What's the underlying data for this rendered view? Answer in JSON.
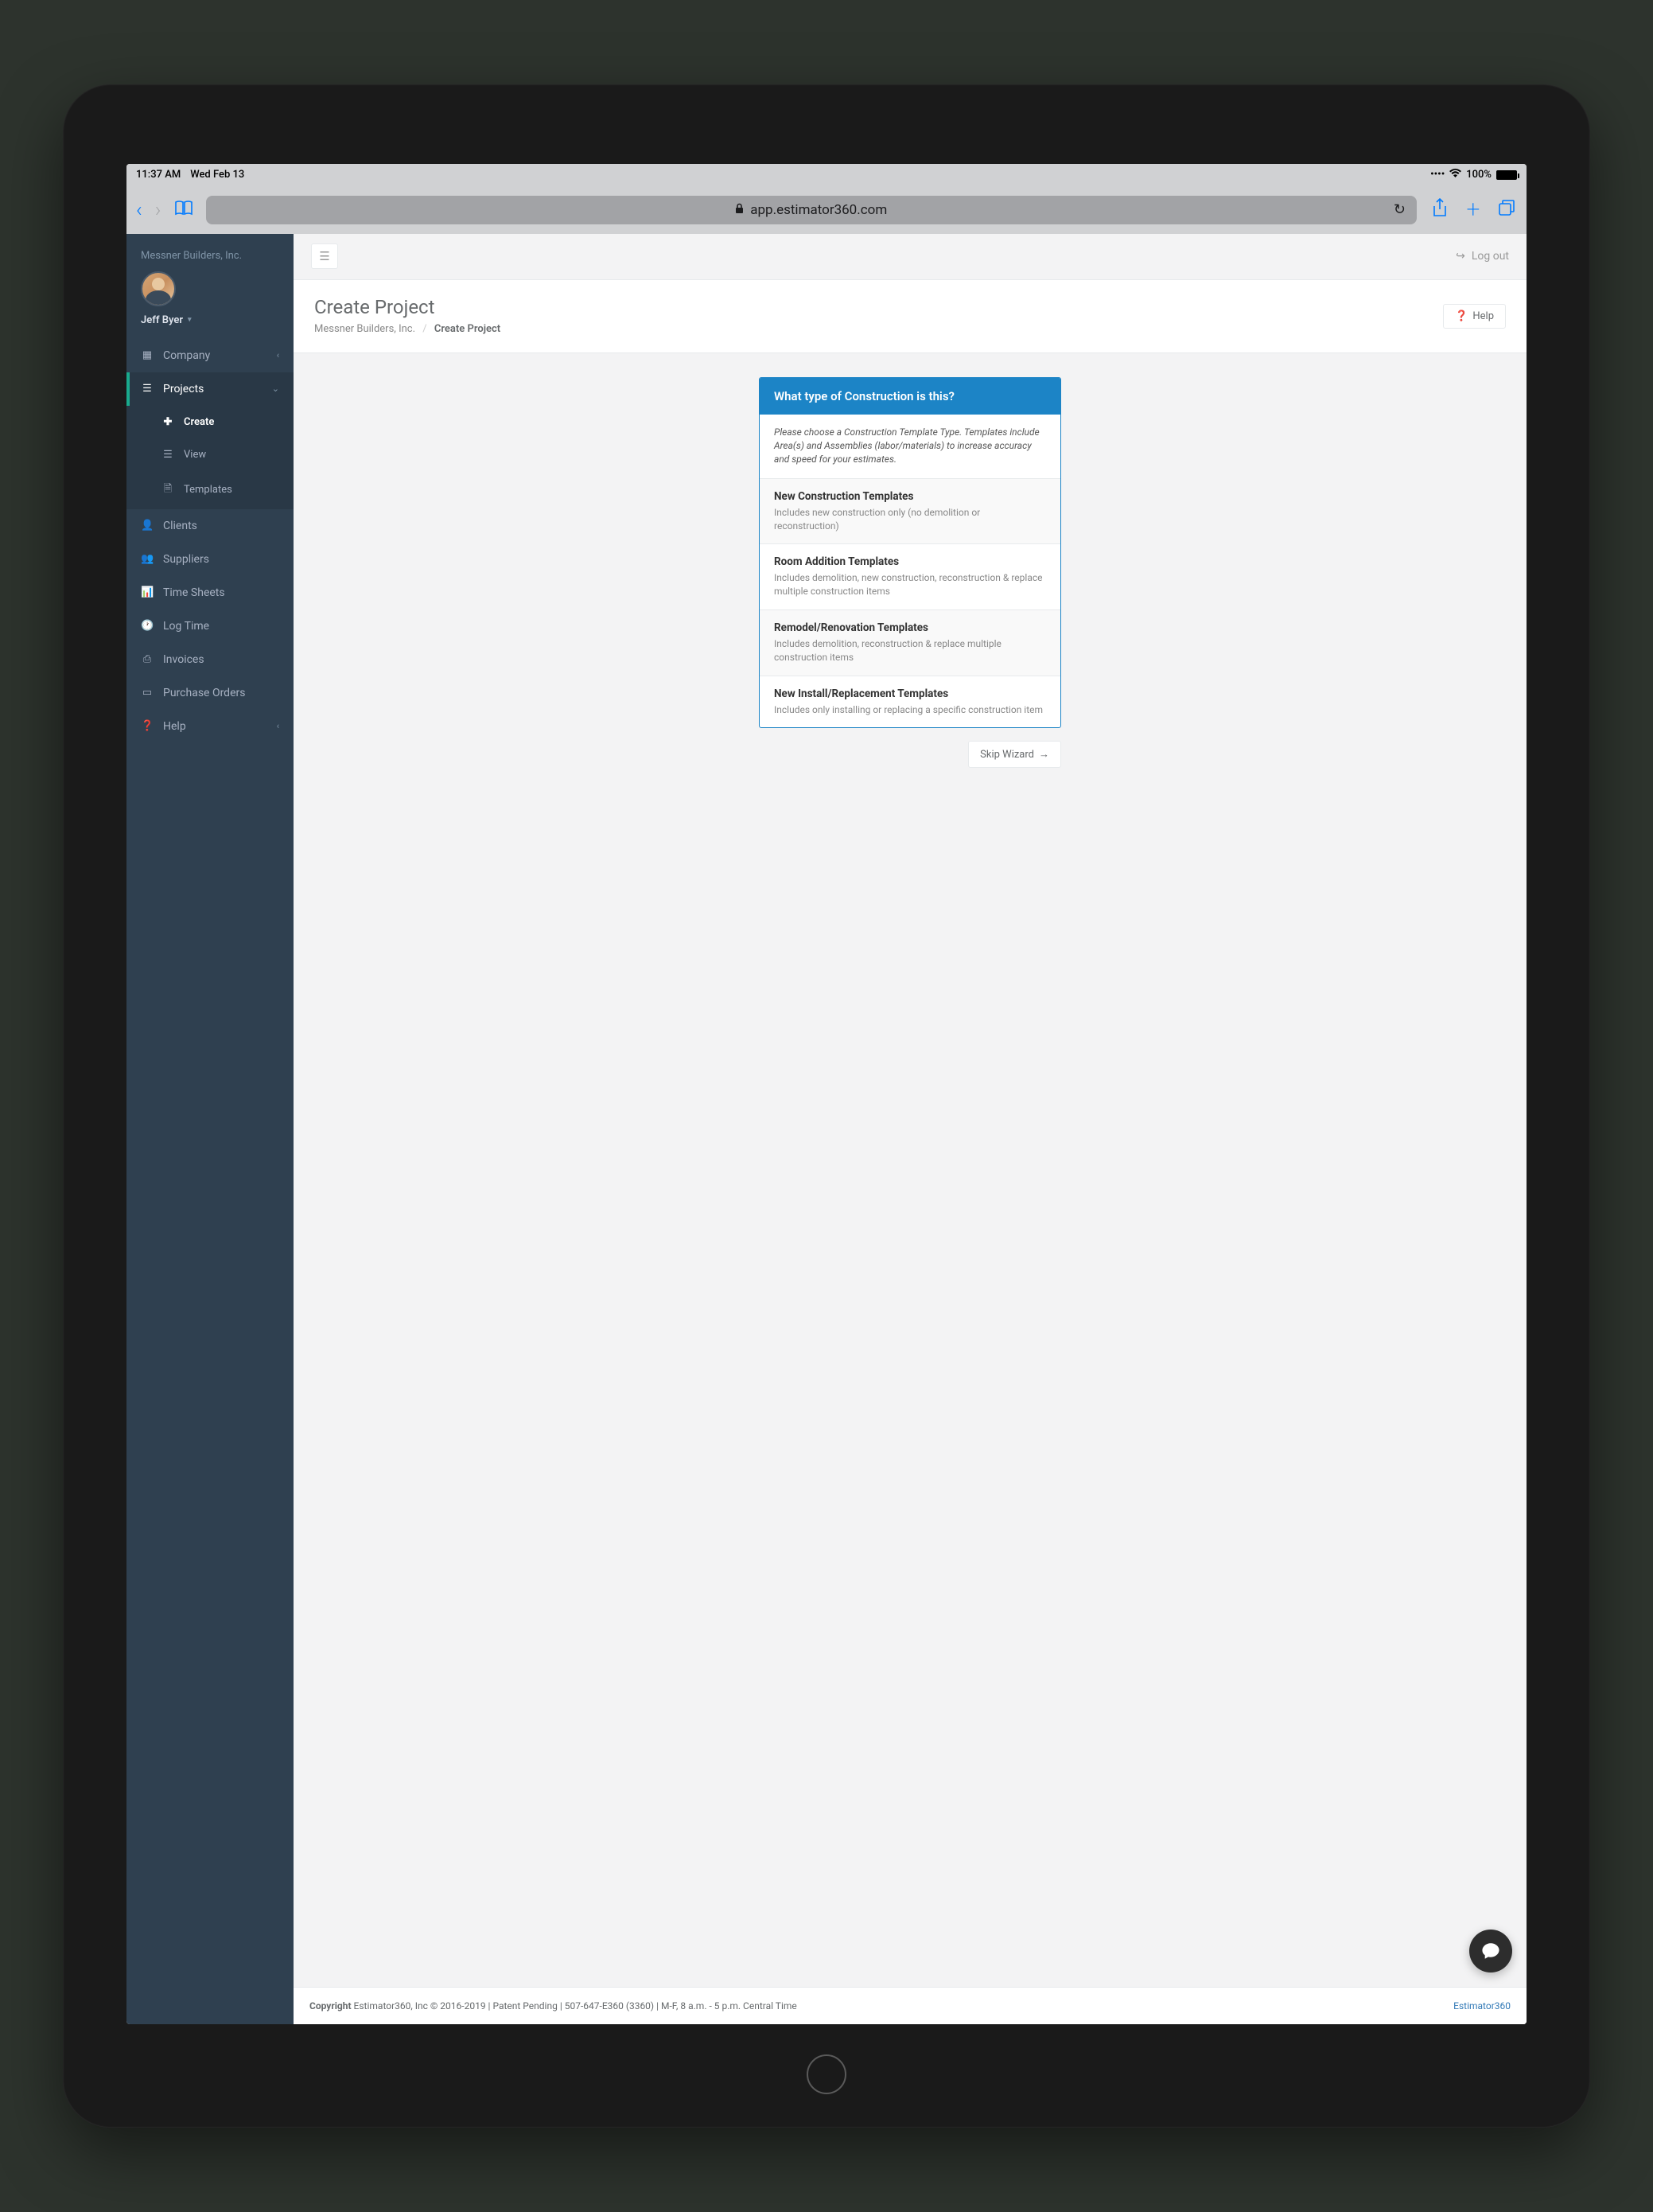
{
  "status_bar": {
    "time": "11:37 AM",
    "date": "Wed Feb 13",
    "battery": "100%"
  },
  "browser": {
    "url": "app.estimator360.com"
  },
  "sidebar": {
    "company": "Messner Builders, Inc.",
    "user": "Jeff Byer",
    "nav": {
      "company": "Company",
      "projects": "Projects",
      "create": "Create",
      "view": "View",
      "templates": "Templates",
      "clients": "Clients",
      "suppliers": "Suppliers",
      "timesheets": "Time Sheets",
      "logtime": "Log Time",
      "invoices": "Invoices",
      "purchaseorders": "Purchase Orders",
      "help": "Help"
    }
  },
  "topbar": {
    "logout": "Log out"
  },
  "page": {
    "title": "Create Project",
    "breadcrumb_root": "Messner Builders, Inc.",
    "breadcrumb_current": "Create Project",
    "help_btn": "Help"
  },
  "wizard": {
    "header": "What type of Construction is this?",
    "intro": "Please choose a Construction Template Type. Templates include Area(s) and Assemblies (labor/materials) to increase accuracy and speed for your estimates.",
    "options": [
      {
        "title": "New Construction Templates",
        "desc": "Includes new construction only (no demolition or reconstruction)"
      },
      {
        "title": "Room Addition Templates",
        "desc": "Includes demolition, new construction, reconstruction & replace multiple construction items"
      },
      {
        "title": "Remodel/Renovation Templates",
        "desc": "Includes demolition, reconstruction & replace multiple construction items"
      },
      {
        "title": "New Install/Replacement Templates",
        "desc": "Includes only installing or replacing a specific construction item"
      }
    ],
    "skip": "Skip Wizard"
  },
  "footer": {
    "copyright_label": "Copyright",
    "text": "Estimator360, Inc © 2016-2019 | Patent Pending | 507-647-E360 (3360) | M-F, 8 a.m. - 5 p.m. Central Time",
    "link": "Estimator360"
  }
}
